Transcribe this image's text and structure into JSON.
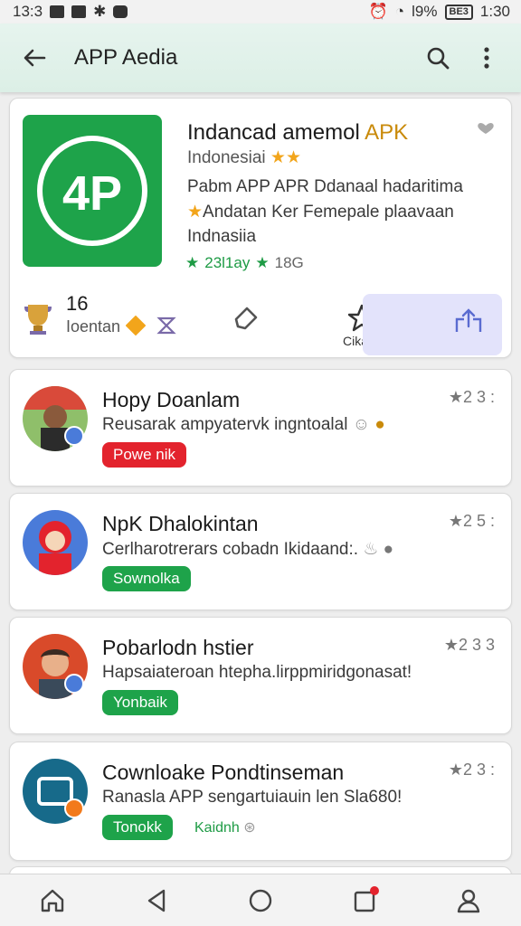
{
  "status_bar": {
    "time_left": "13:3",
    "battery_pct": "l9%",
    "battery_box": "BE3",
    "time_right": "1:30"
  },
  "app_bar": {
    "title": "APP Aedia",
    "icons": [
      "back-arrow-icon",
      "search-icon",
      "more-vert-icon"
    ]
  },
  "featured": {
    "name": "Indancad amemol ",
    "name_accent": "APK",
    "line1": "Indonesiai ",
    "line2": "Pabm APP APR Ddanaal hadaritima",
    "line3": "Andatan Ker Femepale plaavaan",
    "line4": "Indnasiia",
    "rating_text": "23l1ay",
    "rating_count": "18G",
    "stat_number": "16",
    "stat_label": "Ioentan",
    "action_label": "Cikaa",
    "colors": {
      "brand": "#1ea34a",
      "accent": "#f2a51b"
    }
  },
  "items": [
    {
      "name": "Hopy Doanlam",
      "desc": "Reusarak ampyatervk ingntoalal",
      "rating": "★2 3 :",
      "button": "Powe nik",
      "button_color": "red"
    },
    {
      "name": "NpK Dhalokintan",
      "desc": "Cerlharotrerars cobadn Ikidaand:.",
      "rating": "★2 5 :",
      "button": "Sownolka",
      "button_color": "green"
    },
    {
      "name": "Pobarlodn hstier",
      "desc": "Hapsaiateroan htepha.lirppmiridgonasat!",
      "rating": "★2 3 3",
      "button": "Yonbaik",
      "button_color": "green"
    },
    {
      "name": "Cownloake Pondtinseman",
      "desc": "Ranasla APP  sengartuiauin len Sla680!",
      "rating": "★2 3 :",
      "button": "Tonokk",
      "button_color": "green",
      "extra": "Kaidnh"
    }
  ],
  "bottom_nav": [
    "home-icon",
    "back-nav-icon",
    "home-circle-icon",
    "notifications-icon",
    "profile-icon"
  ]
}
